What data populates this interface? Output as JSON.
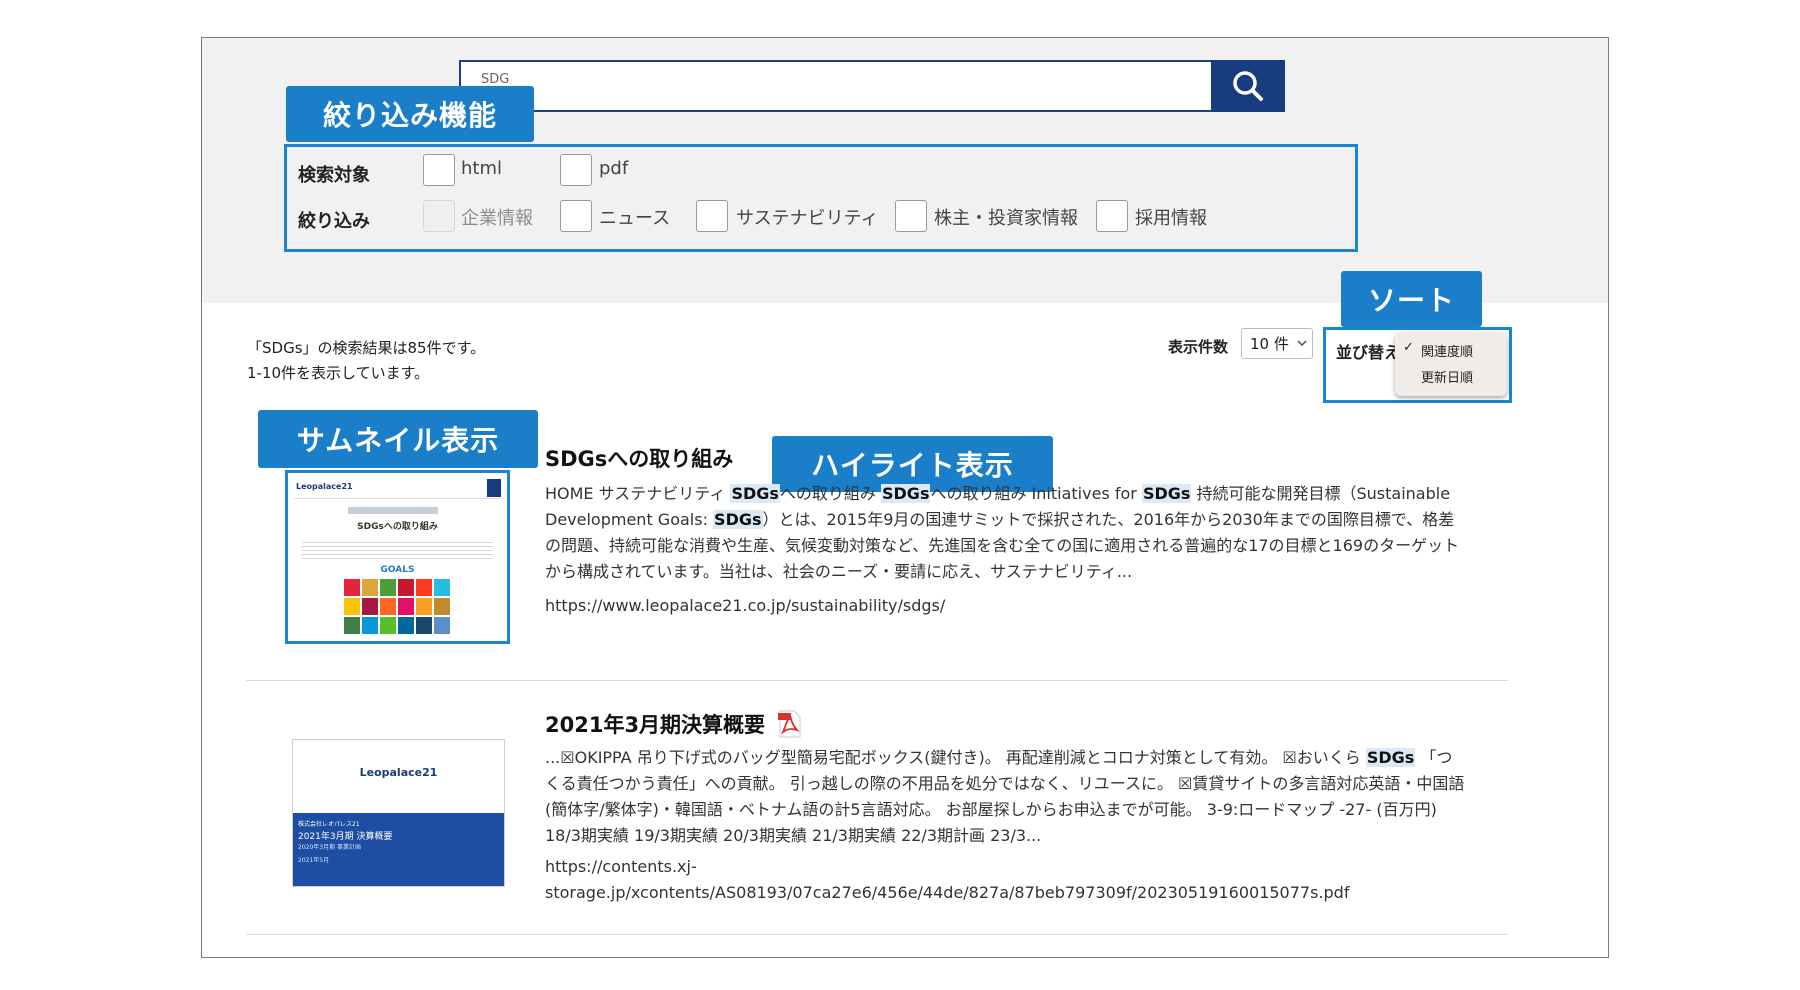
{
  "search": {
    "query": "SDG",
    "button_icon": "search-icon"
  },
  "callouts": {
    "filter": "絞り込み機能",
    "sort": "ソート",
    "thumbnail": "サムネイル表示",
    "highlight": "ハイライト表示"
  },
  "filters": {
    "target_label": "検索対象",
    "target_options": [
      {
        "label": "html",
        "checked": false,
        "disabled": false
      },
      {
        "label": "pdf",
        "checked": false,
        "disabled": false
      }
    ],
    "narrow_label": "絞り込み",
    "narrow_options": [
      {
        "label": "企業情報",
        "checked": false,
        "disabled": true
      },
      {
        "label": "ニュース",
        "checked": false,
        "disabled": false
      },
      {
        "label": "サステナビリティ",
        "checked": false,
        "disabled": false
      },
      {
        "label": "株主・投資家情報",
        "checked": false,
        "disabled": false
      },
      {
        "label": "採用情報",
        "checked": false,
        "disabled": false
      }
    ]
  },
  "summary": {
    "line1": "「SDGs」の検索結果は85件です。",
    "line2": "1-10件を表示しています。"
  },
  "display_count": {
    "label": "表示件数",
    "value": "10 件"
  },
  "sort": {
    "label": "並び替え",
    "options": [
      {
        "label": "関連度順",
        "selected": true
      },
      {
        "label": "更新日順",
        "selected": false
      }
    ],
    "check_mark": "✓"
  },
  "results": [
    {
      "title": "SDGsへの取り組み",
      "thumb": {
        "brand": "Leopalace21",
        "heading": "SDGsへの取り組み",
        "goals_label": "GOALS"
      },
      "snippet_parts": [
        {
          "t": "HOME サステナビリティ "
        },
        {
          "t": "SDGs",
          "hl": true
        },
        {
          "t": "への取り組み "
        },
        {
          "t": "SDGs",
          "hl": true
        },
        {
          "t": "への取り組み Initiatives for "
        },
        {
          "t": "SDGs",
          "hl": true
        },
        {
          "t": " 持続可能な開発目標（Sustainable Development Goals: "
        },
        {
          "t": "SDGs",
          "hl": true
        },
        {
          "t": "）とは、2015年9月の国連サミットで採択された、2016年から2030年までの国際目標で、格差の問題、持続可能な消費や生産、気候変動対策など、先進国を含む全ての国に適用される普遍的な17の目標と169のターゲットから構成されています。当社は、社会のニーズ・要請に応え、サステナビリティ..."
        }
      ],
      "url": "https://www.leopalace21.co.jp/sustainability/sdgs/"
    },
    {
      "title": "2021年3月期決算概要",
      "file_icon": "pdf-icon",
      "thumb": {
        "brand": "Leopalace21",
        "company": "株式会社レオパレス21",
        "heading": "2021年3月期 決算概要",
        "sub": "2020年3月期 事業計画",
        "date": "2021年5月"
      },
      "snippet_parts": [
        {
          "t": "...☒OKIPPA 吊り下げ式のバッグ型簡易宅配ボックス(鍵付き)。 再配達削減とコロナ対策として有効。 ☒おいくら "
        },
        {
          "t": "SDGs",
          "hl": true
        },
        {
          "t": " 「つくる責任つかう責任」への貢献。 引っ越しの際の不用品を処分ではなく、リユースに。 ☒賃貸サイトの多言語対応英語・中国語(簡体字/繁体字)・韓国語・ベトナム語の計5言語対応。 お部屋探しからお申込までが可能。 3-9:ロードマップ -27- (百万円) 18/3期実績 19/3期実績 20/3期実績 21/3期実績 22/3期計画 23/3..."
        }
      ],
      "url_line1": "https://contents.xj-",
      "url_line2": "storage.jp/xcontents/AS08193/07ca27e6/456e/44de/827a/87beb797309f/20230519160015077s.pdf"
    }
  ],
  "colors": {
    "navy": "#173c80",
    "callout": "#1a7ec9",
    "frame_blue": "#1a86d0",
    "highlight_bg": "#dbe9f7",
    "pdf_red": "#d8332a",
    "gray_band": "#f1f1f1"
  }
}
